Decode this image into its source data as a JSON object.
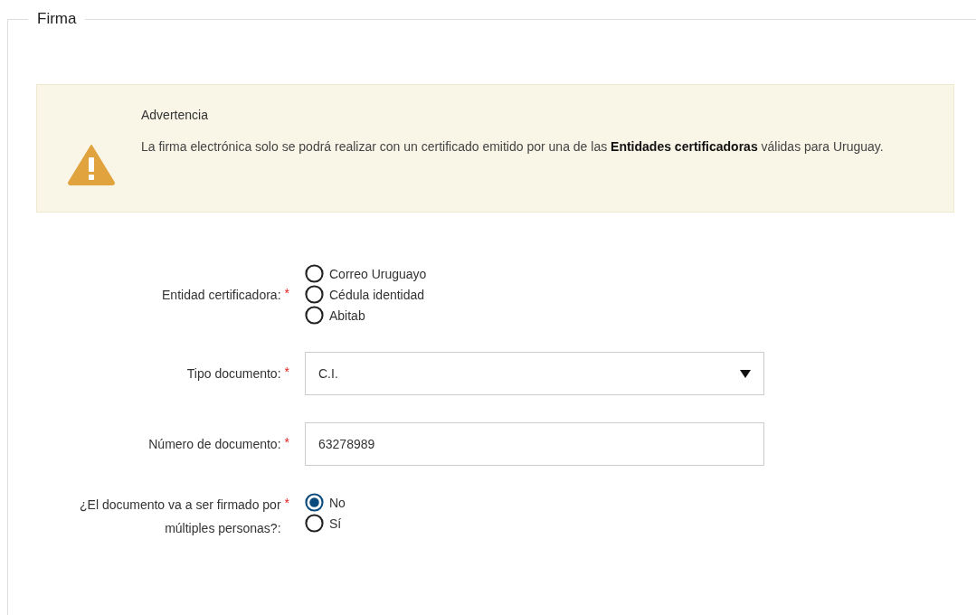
{
  "section": {
    "legend": "Firma"
  },
  "alert": {
    "title": "Advertencia",
    "message": "La firma electrónica solo se podrá realizar con un certificado emitido por una de las **Entidades certificadoras** válidas para Uruguay."
  },
  "fields": [
    {
      "kind": "radio",
      "label": "Entidad certificadora:",
      "required_mark": "*",
      "options": [
        {
          "label": "Correo Uruguayo",
          "selected": false
        },
        {
          "label": "Cédula identidad",
          "selected": false
        },
        {
          "label": "Abitab",
          "selected": false
        }
      ]
    },
    {
      "kind": "select",
      "label": "Tipo documento:",
      "required_mark": "*",
      "value": "C.I."
    },
    {
      "kind": "text",
      "label": "Número de documento:",
      "required_mark": "*",
      "value": "63278989"
    },
    {
      "kind": "radio",
      "label": "¿El documento va a ser firmado por múltiples personas?:",
      "required_mark": "*",
      "options": [
        {
          "label": "No",
          "selected": true
        },
        {
          "label": "Sí",
          "selected": false
        }
      ]
    }
  ]
}
